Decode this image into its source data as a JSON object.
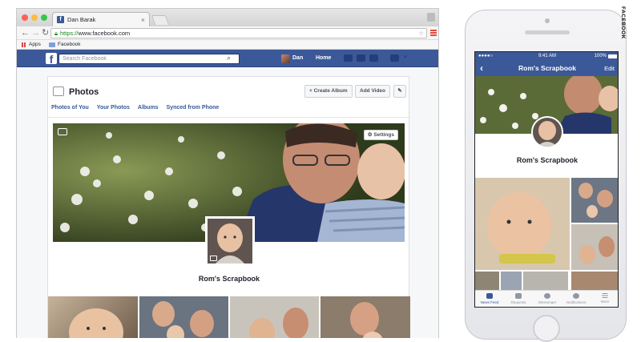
{
  "browser": {
    "tab_title": "Dan Barak",
    "url_scheme": "https://",
    "url_host": "www.facebook.com",
    "bookmarks": {
      "apps": "Apps",
      "facebook": "Facebook"
    }
  },
  "fb": {
    "search_placeholder": "Search Facebook",
    "user_name": "Dan",
    "home": "Home",
    "page_title": "Photos",
    "create_album": "+ Create Album",
    "add_video": "Add Video",
    "tabs": [
      "Photos of You",
      "Your Photos",
      "Albums",
      "Synced from Phone"
    ],
    "settings": "Settings",
    "album_name": "Rom's Scrapbook"
  },
  "phone": {
    "time": "9:41 AM",
    "battery": "100%",
    "title": "Rom's Scrapbook",
    "edit": "Edit",
    "album_name": "Rom's Scrapbook",
    "tabs": [
      "News Feed",
      "Requests",
      "Messenger",
      "Notifications",
      "More"
    ]
  },
  "watermark": "FACEBOOK",
  "colors": {
    "fb_blue": "#3b5998",
    "link": "#365899"
  }
}
